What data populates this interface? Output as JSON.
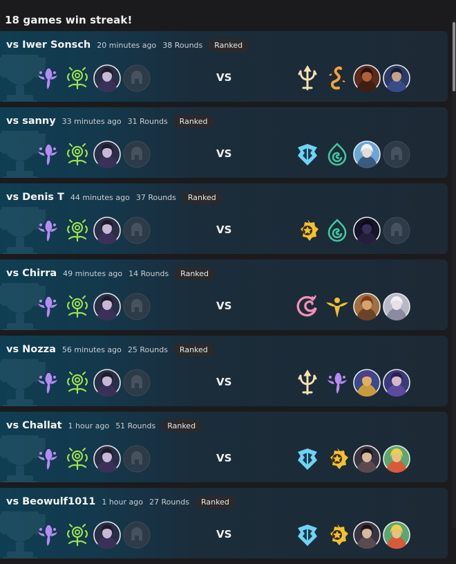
{
  "streak_text": "18 games win streak!",
  "vs_label": "VS",
  "colors": {
    "card_accent": "#0f3e52",
    "badge_bg": "#2a2a2c",
    "purple": "#b78bf5",
    "green": "#9de04f",
    "gold": "#f2c12e",
    "orange": "#f2a23a",
    "cream": "#f4e2b0",
    "ice": "#6fd3f5",
    "teal": "#3fc8a0",
    "pink": "#f48fb7"
  },
  "matches": [
    {
      "opponent": "vs Iwer Sonsch",
      "time": "20 minutes ago",
      "rounds": "38 Rounds",
      "mode": "Ranked",
      "player": [
        "purple-spirit-icon",
        "green-vine-icon",
        "dark-hero-portrait",
        "locked-helmet-icon"
      ],
      "enemy": [
        "cream-trident-icon",
        "orange-serpent-icon",
        "masked-brawler-portrait",
        "armored-captain-portrait"
      ]
    },
    {
      "opponent": "vs sanny",
      "time": "33 minutes ago",
      "rounds": "31 Rounds",
      "mode": "Ranked",
      "player": [
        "purple-spirit-icon",
        "green-vine-icon",
        "dark-hero-portrait",
        "locked-helmet-icon"
      ],
      "enemy": [
        "ice-crest-icon",
        "teal-swirl-icon",
        "white-haired-portrait",
        "locked-helmet-icon"
      ]
    },
    {
      "opponent": "vs Denis T",
      "time": "44 minutes ago",
      "rounds": "37 Rounds",
      "mode": "Ranked",
      "player": [
        "purple-spirit-icon",
        "green-vine-icon",
        "dark-hero-portrait",
        "locked-helmet-icon"
      ],
      "enemy": [
        "gold-gear-icon",
        "teal-swirl-icon",
        "shadow-knight-portrait",
        "locked-helmet-icon"
      ]
    },
    {
      "opponent": "vs Chirra",
      "time": "49 minutes ago",
      "rounds": "14 Rounds",
      "mode": "Ranked",
      "player": [
        "purple-spirit-icon",
        "green-vine-icon",
        "dark-hero-portrait",
        "locked-helmet-icon"
      ],
      "enemy": [
        "pink-dragon-icon",
        "gold-wings-icon",
        "desert-warrior-portrait",
        "silver-sorceress-portrait"
      ]
    },
    {
      "opponent": "vs Nozza",
      "time": "56 minutes ago",
      "rounds": "25 Rounds",
      "mode": "Ranked",
      "player": [
        "purple-spirit-icon",
        "green-vine-icon",
        "dark-hero-portrait",
        "locked-helmet-icon"
      ],
      "enemy": [
        "cream-trident-icon",
        "purple-spirit-icon",
        "yordle-portrait",
        "violet-mage-portrait"
      ]
    },
    {
      "opponent": "vs Challat",
      "time": "1 hour ago",
      "rounds": "51 Rounds",
      "mode": "Ranked",
      "player": [
        "purple-spirit-icon",
        "green-vine-icon",
        "dark-hero-portrait",
        "locked-helmet-icon"
      ],
      "enemy": [
        "ice-crest-icon",
        "gold-gear-icon",
        "dark-haired-portrait",
        "goggles-portrait"
      ]
    },
    {
      "opponent": "vs Beowulf1011",
      "time": "1 hour ago",
      "rounds": "27 Rounds",
      "mode": "Ranked",
      "player": [
        "purple-spirit-icon",
        "green-vine-icon",
        "dark-hero-portrait",
        "locked-helmet-icon"
      ],
      "enemy": [
        "ice-crest-icon",
        "gold-gear-icon",
        "dark-haired-portrait",
        "goggles-portrait"
      ]
    }
  ]
}
